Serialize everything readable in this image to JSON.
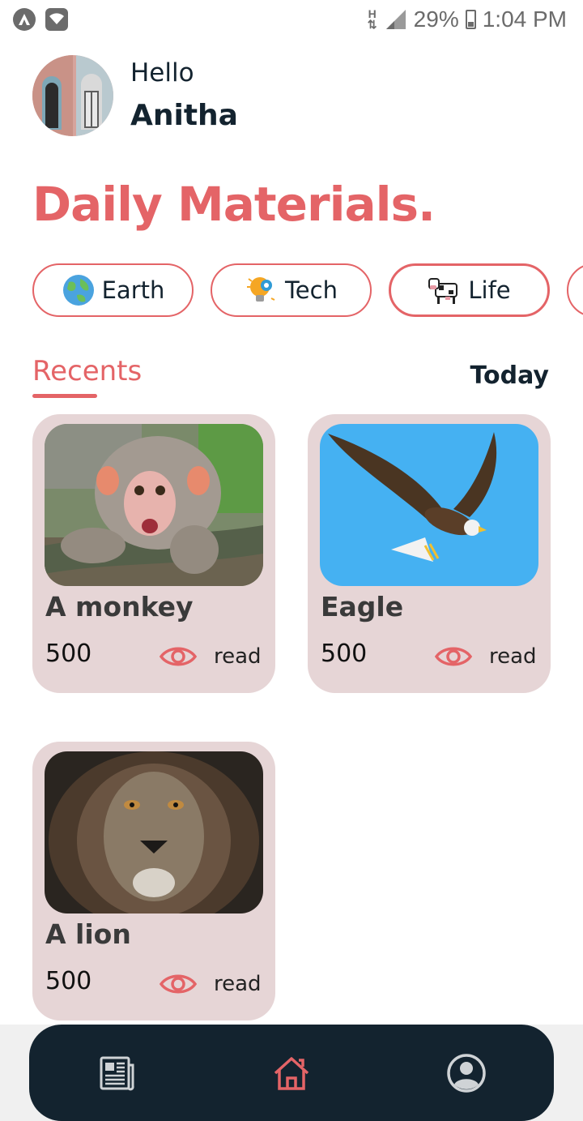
{
  "status_bar": {
    "battery": "29%",
    "time": "1:04 PM",
    "data_indicator": "H",
    "icons": [
      "app-notification-icon",
      "wifi-icon",
      "mobile-data-icon",
      "signal-icon",
      "battery-icon"
    ]
  },
  "header": {
    "greeting": "Hello",
    "user_name": "Anitha"
  },
  "page": {
    "title": "Daily Materials."
  },
  "categories": [
    {
      "label": "Earth",
      "icon": "earth-globe-icon"
    },
    {
      "label": "Tech",
      "icon": "lightbulb-gear-icon"
    },
    {
      "label": "Life",
      "icon": "cow-icon"
    }
  ],
  "section": {
    "tab_active": "Recents",
    "tab_right": "Today"
  },
  "cards": [
    {
      "title": "A monkey",
      "count": "500",
      "action": "read",
      "image": "monkey-photo"
    },
    {
      "title": "Eagle",
      "count": "500",
      "action": "read",
      "image": "eagle-photo"
    },
    {
      "title": "A lion",
      "count": "500",
      "action": "read",
      "image": "lion-photo"
    }
  ],
  "bottom_nav": {
    "items": [
      "newspaper-icon",
      "home-icon",
      "profile-icon"
    ],
    "active": "home-icon"
  },
  "colors": {
    "accent": "#e46467",
    "dark": "#13232f",
    "card_bg": "#e6d5d6"
  }
}
